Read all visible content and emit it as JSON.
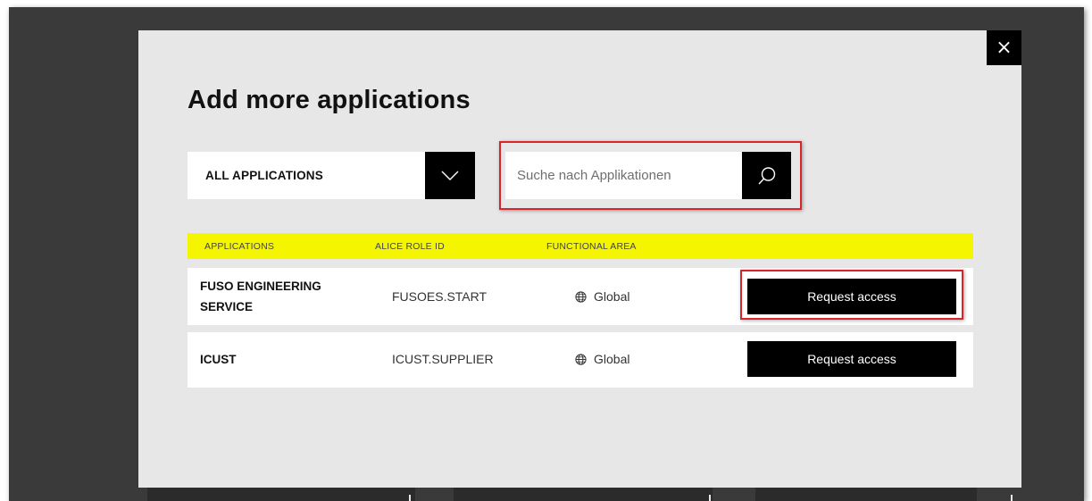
{
  "modal": {
    "title": "Add more applications",
    "close_label": "×"
  },
  "filter": {
    "selected": "ALL APPLICATIONS"
  },
  "search": {
    "placeholder": "Suche nach Applikationen",
    "value": ""
  },
  "table": {
    "columns": [
      "APPLICATIONS",
      "ALICE ROLE ID",
      "FUNCTIONAL AREA"
    ],
    "rows": [
      {
        "app_line1": "FUSO ENGINEERING",
        "app_line2": "SERVICE",
        "role_id": "FUSOES.START",
        "area": "Global",
        "action": "Request access"
      },
      {
        "app_line1": "ICUST",
        "app_line2": "",
        "role_id": "ICUST.SUPPLIER",
        "area": "Global",
        "action": "Request access"
      }
    ]
  },
  "icons": {
    "close": "close-icon",
    "dropdown": "chevron-down-icon",
    "search": "search-icon",
    "area": "globe-icon"
  },
  "colors": {
    "header_highlight": "#f5f500",
    "annotation_red": "#d9242b",
    "button_black": "#000000",
    "modal_bg": "#e7e7e7"
  }
}
